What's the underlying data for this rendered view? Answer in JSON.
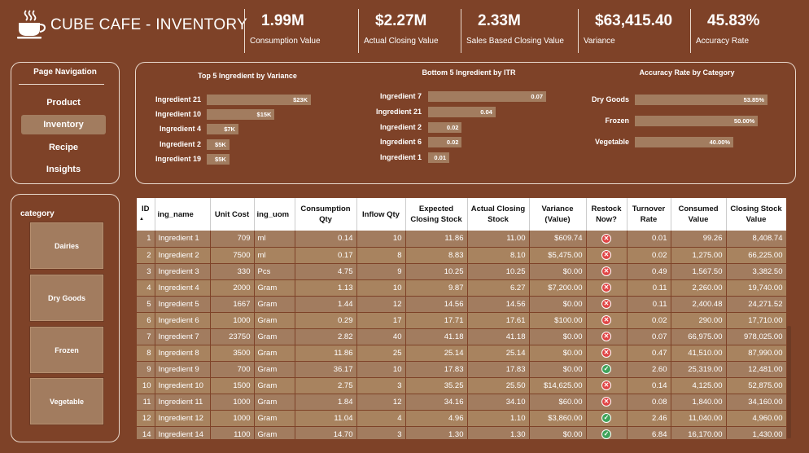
{
  "header": {
    "title": "CUBE CAFE -  INVENTORY",
    "logo_icon": "coffee-cup-icon"
  },
  "kpis": [
    {
      "value": "1.99M",
      "label": "Consumption Value"
    },
    {
      "value": "$2.27M",
      "label": "Actual Closing Value"
    },
    {
      "value": "2.33M",
      "label": "Sales Based Closing Value"
    },
    {
      "value": "$63,415.40",
      "label": "Variance"
    },
    {
      "value": "45.83%",
      "label": "Accuracy Rate"
    }
  ],
  "nav": {
    "title": "Page Navigation",
    "items": [
      {
        "label": "Product"
      },
      {
        "label": "Inventory"
      },
      {
        "label": "Recipe"
      },
      {
        "label": "Insights"
      }
    ],
    "active": "Inventory"
  },
  "category": {
    "title": "category",
    "items": [
      {
        "label": "Dairies"
      },
      {
        "label": "Dry Goods"
      },
      {
        "label": "Frozen"
      },
      {
        "label": "Vegetable"
      }
    ]
  },
  "chart_data": [
    {
      "type": "bar",
      "title": "Top 5 Ingredient by Variance",
      "categories": [
        "Ingredient 21",
        "Ingredient 10",
        "Ingredient 4",
        "Ingredient 2",
        "Ingredient 19"
      ],
      "values": [
        23000,
        15000,
        7000,
        5000,
        5000
      ],
      "value_labels": [
        "$23K",
        "$15K",
        "$7K",
        "$5K",
        "$5K"
      ]
    },
    {
      "type": "bar",
      "title": "Bottom 5 Ingredient by ITR",
      "categories": [
        "Ingredient 7",
        "Ingredient 21",
        "Ingredient 2",
        "Ingredient 6",
        "Ingredient 1"
      ],
      "values": [
        0.07,
        0.04,
        0.02,
        0.02,
        0.01
      ],
      "value_labels": [
        "0.07",
        "0.04",
        "0.02",
        "0.02",
        "0.01"
      ]
    },
    {
      "type": "bar",
      "title": "Accuracy Rate by Category",
      "categories": [
        "Dry Goods",
        "Frozen",
        "Vegetable"
      ],
      "values": [
        53.85,
        50.0,
        40.0
      ],
      "value_labels": [
        "53.85%",
        "50.00%",
        "40.00%"
      ]
    }
  ],
  "table": {
    "columns": [
      "ID",
      "ing_name",
      "Unit Cost",
      "ing_uom",
      "Consumption Qty",
      "Inflow Qty",
      "Expected Closing Stock",
      "Actual Closing Stock",
      "Variance (Value)",
      "Restock Now?",
      "Turnover Rate",
      "Consumed Value",
      "Closing Stock Value"
    ],
    "sort_indicator": "▲",
    "rows": [
      [
        "1",
        "Ingredient 1",
        "709",
        "ml",
        "0.14",
        "10",
        "11.86",
        "11.00",
        "$609.74",
        "no",
        "0.01",
        "99.26",
        "8,408.74"
      ],
      [
        "2",
        "Ingredient 2",
        "7500",
        "ml",
        "0.17",
        "8",
        "8.83",
        "8.10",
        "$5,475.00",
        "no",
        "0.02",
        "1,275.00",
        "66,225.00"
      ],
      [
        "3",
        "Ingredient 3",
        "330",
        "Pcs",
        "4.75",
        "9",
        "10.25",
        "10.25",
        "$0.00",
        "no",
        "0.49",
        "1,567.50",
        "3,382.50"
      ],
      [
        "4",
        "Ingredient 4",
        "2000",
        "Gram",
        "1.13",
        "10",
        "9.87",
        "6.27",
        "$7,200.00",
        "no",
        "0.11",
        "2,260.00",
        "19,740.00"
      ],
      [
        "5",
        "Ingredient 5",
        "1667",
        "Gram",
        "1.44",
        "12",
        "14.56",
        "14.56",
        "$0.00",
        "no",
        "0.11",
        "2,400.48",
        "24,271.52"
      ],
      [
        "6",
        "Ingredient 6",
        "1000",
        "Gram",
        "0.29",
        "17",
        "17.71",
        "17.61",
        "$100.00",
        "no",
        "0.02",
        "290.00",
        "17,710.00"
      ],
      [
        "7",
        "Ingredient 7",
        "23750",
        "Gram",
        "2.82",
        "40",
        "41.18",
        "41.18",
        "$0.00",
        "no",
        "0.07",
        "66,975.00",
        "978,025.00"
      ],
      [
        "8",
        "Ingredient 8",
        "3500",
        "Gram",
        "11.86",
        "25",
        "25.14",
        "25.14",
        "$0.00",
        "no",
        "0.47",
        "41,510.00",
        "87,990.00"
      ],
      [
        "9",
        "Ingredient 9",
        "700",
        "Gram",
        "36.17",
        "10",
        "17.83",
        "17.83",
        "$0.00",
        "yes",
        "2.60",
        "25,319.00",
        "12,481.00"
      ],
      [
        "10",
        "Ingredient 10",
        "1500",
        "Gram",
        "2.75",
        "3",
        "35.25",
        "25.50",
        "$14,625.00",
        "no",
        "0.14",
        "4,125.00",
        "52,875.00"
      ],
      [
        "11",
        "Ingredient 11",
        "1000",
        "Gram",
        "1.84",
        "12",
        "34.16",
        "34.10",
        "$60.00",
        "no",
        "0.08",
        "1,840.00",
        "34,160.00"
      ],
      [
        "12",
        "Ingredient 12",
        "1000",
        "Gram",
        "11.04",
        "4",
        "4.96",
        "1.10",
        "$3,860.00",
        "yes",
        "2.46",
        "11,040.00",
        "4,960.00"
      ],
      [
        "14",
        "Ingredient 14",
        "1100",
        "Gram",
        "14.70",
        "3",
        "1.30",
        "1.30",
        "$0.00",
        "yes",
        "6.84",
        "16,170.00",
        "1,430.00"
      ]
    ]
  },
  "colors": {
    "background": "#7e4228",
    "accent": "#a27c5f",
    "restock_no": "#e04545",
    "restock_yes": "#3fa35a"
  }
}
